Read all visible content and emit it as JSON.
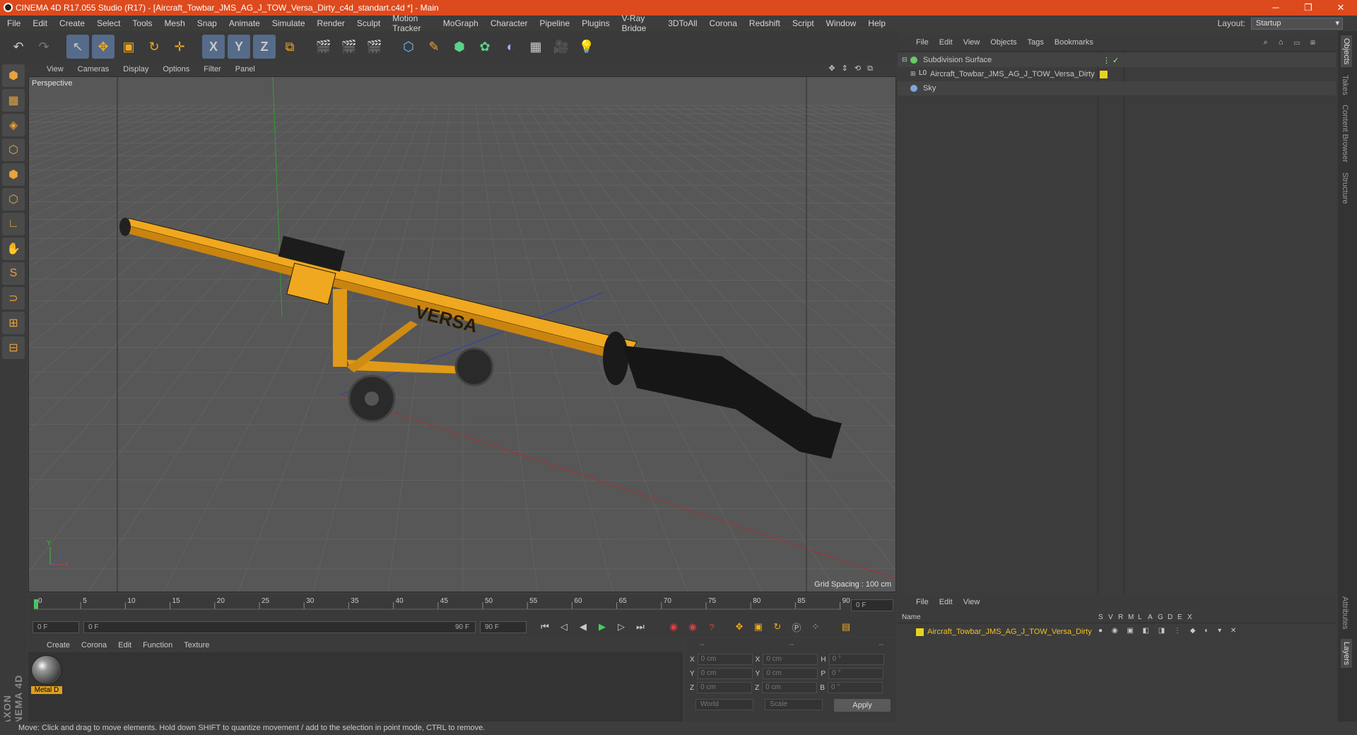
{
  "window": {
    "title": "CINEMA 4D R17.055 Studio (R17) - [Aircraft_Towbar_JMS_AG_J_TOW_Versa_Dirty_c4d_standart.c4d *] - Main",
    "minimize": "─",
    "maximize": "❐",
    "close": "✕"
  },
  "menu": [
    "File",
    "Edit",
    "Create",
    "Select",
    "Tools",
    "Mesh",
    "Snap",
    "Animate",
    "Simulate",
    "Render",
    "Sculpt",
    "Motion Tracker",
    "MoGraph",
    "Character",
    "Pipeline",
    "Plugins",
    "V-Ray Bridge",
    "3DToAll",
    "Corona",
    "Redshift",
    "Script",
    "Window",
    "Help"
  ],
  "layout": {
    "label": "Layout:",
    "value": "Startup"
  },
  "toolbar": {
    "undo": "↶",
    "redo": "↷",
    "select": "↖",
    "move": "✥",
    "scale": "▣",
    "rotate": "↻",
    "move2": "✛",
    "x": "X",
    "y": "Y",
    "z": "Z",
    "coord": "⧉",
    "render1": "🎬",
    "render2": "🎬",
    "render3": "🎬",
    "cube": "⬡",
    "pen": "✎",
    "subdiv": "⬢",
    "cloner": "✿",
    "deformer": "◐",
    "floor": "▦",
    "camera": "🎥",
    "light": "💡"
  },
  "left_tools": [
    "⬢",
    "▦",
    "◈",
    "⬡",
    "⬢",
    "⬡",
    "∟",
    "✋",
    "S",
    "⊃",
    "⊞",
    "⊟"
  ],
  "viewport": {
    "menu": [
      "View",
      "Cameras",
      "Display",
      "Options",
      "Filter",
      "Panel"
    ],
    "controls": "✥ ⇕ ⟲ ⧉",
    "label": "Perspective",
    "grid_spacing": "Grid Spacing : 100 cm",
    "axis_x": "X",
    "axis_y": "Y",
    "axis_z": "Z"
  },
  "timeline": {
    "ticks": [
      "0",
      "5",
      "10",
      "15",
      "20",
      "25",
      "30",
      "35",
      "40",
      "45",
      "50",
      "55",
      "60",
      "65",
      "70",
      "75",
      "80",
      "85",
      "90"
    ],
    "frame_field": "0 F"
  },
  "frame_controls": {
    "start": "0 F",
    "range_start": "0 F",
    "range_end": "90 F",
    "end": "90 F",
    "buttons": [
      "⏮",
      "◁",
      "◀",
      "▶",
      "▷",
      "⏭"
    ]
  },
  "materials": {
    "menu": [
      "Create",
      "Corona",
      "Edit",
      "Function",
      "Texture"
    ],
    "items": [
      {
        "name": "Metal D"
      }
    ]
  },
  "coordinates": {
    "header": [
      "--",
      "--",
      "--"
    ],
    "rows": [
      {
        "a": "X",
        "av": "0 cm",
        "b": "X",
        "bv": "0 cm",
        "c": "H",
        "cv": "0 °"
      },
      {
        "a": "Y",
        "av": "0 cm",
        "b": "Y",
        "bv": "0 cm",
        "c": "P",
        "cv": "0 °"
      },
      {
        "a": "Z",
        "av": "0 cm",
        "b": "Z",
        "bv": "0 cm",
        "c": "B",
        "cv": "0 °"
      }
    ],
    "mode": "World",
    "scale": "Scale",
    "apply": "Apply"
  },
  "object_manager": {
    "menu": [
      "File",
      "Edit",
      "View",
      "Objects",
      "Tags",
      "Bookmarks"
    ],
    "objects": [
      {
        "name": "Subdivision Surface",
        "icon": "subdivision-icon",
        "color": "#66cc66"
      },
      {
        "name": "Aircraft_Towbar_JMS_AG_J_TOW_Versa_Dirty",
        "icon": "null-icon",
        "color": "#e8d21e"
      },
      {
        "name": "Sky",
        "icon": "sky-icon",
        "color": "#7da6d8"
      }
    ]
  },
  "layer_manager": {
    "menu": [
      "File",
      "Edit",
      "View"
    ],
    "headers": [
      "Name",
      "S",
      "V",
      "R",
      "M",
      "L",
      "A",
      "G",
      "D",
      "E",
      "X"
    ],
    "layers": [
      {
        "name": "Aircraft_Towbar_JMS_AG_J_TOW_Versa_Dirty",
        "color": "#e8d21e"
      }
    ]
  },
  "right_tabs": [
    "Objects",
    "Takes",
    "Content Browser",
    "Structure"
  ],
  "right_tabs_bottom": [
    "Attributes",
    "Layers"
  ],
  "status": "Move: Click and drag to move elements. Hold down SHIFT to quantize movement / add to the selection in point mode, CTRL to remove.",
  "brand": "MAXON CINEMA 4D",
  "accent": "#dd4a1d",
  "model_color": "#f0a820"
}
